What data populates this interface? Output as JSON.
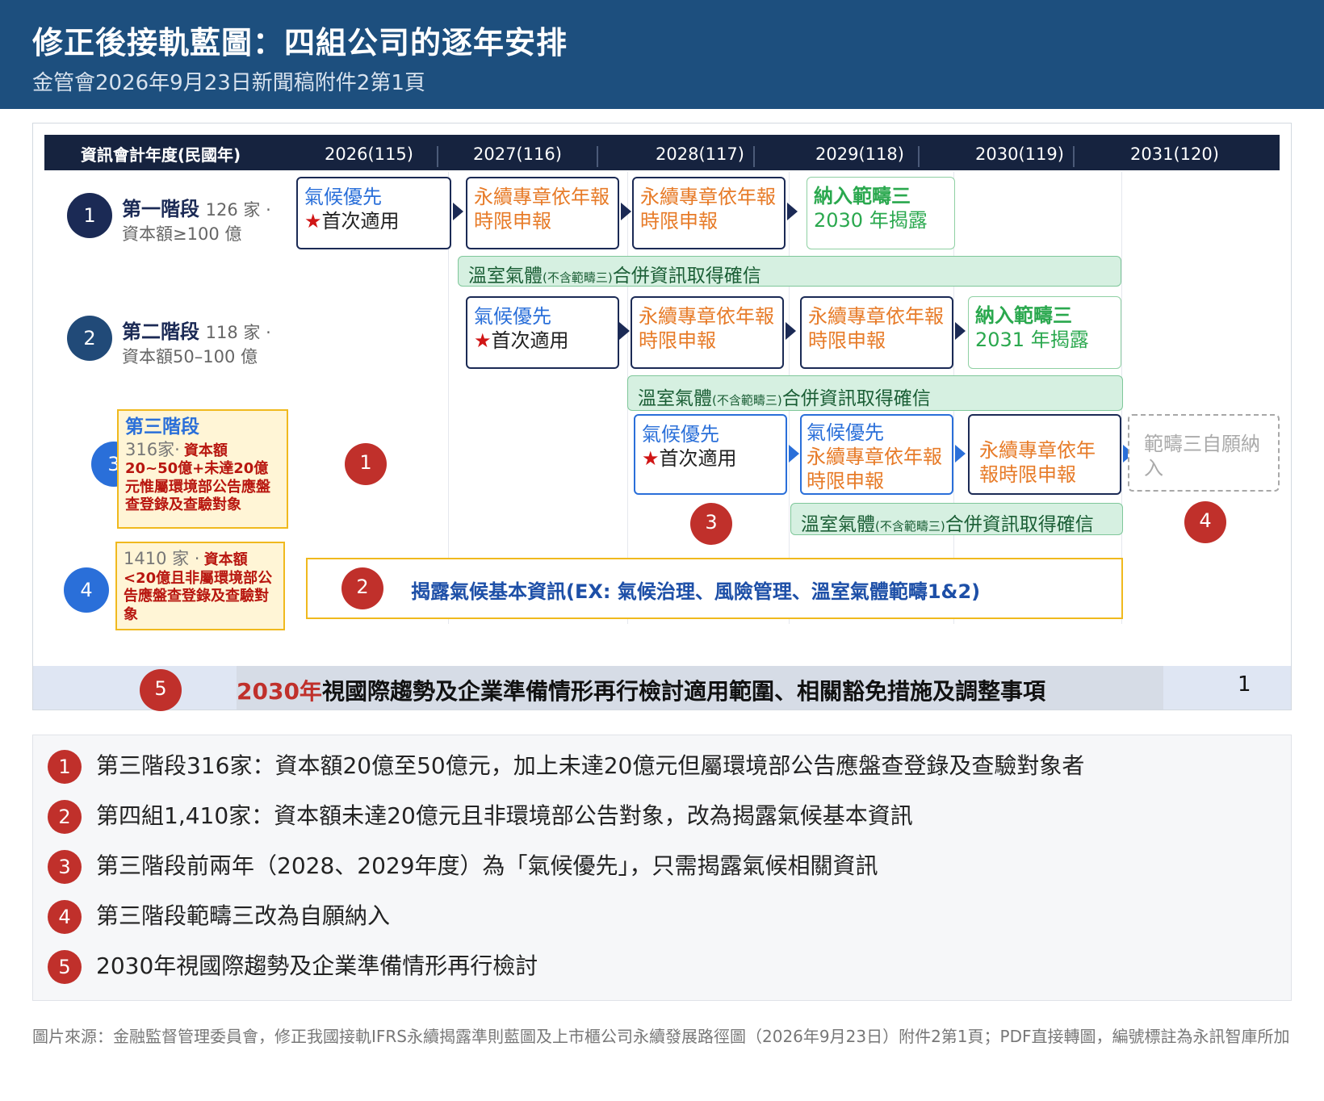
{
  "header": {
    "title": "修正後接軌藍圖：四組公司的逐年安排",
    "subtitle": "金管會2026年9月23日新聞稿附件2第1頁"
  },
  "yearbar": {
    "label": "資訊會計年度(民國年)",
    "years": [
      "2026(115)",
      "2027(116)",
      "2028(117)",
      "2029(118)",
      "2030(119)",
      "2031(120)"
    ]
  },
  "stages": [
    {
      "num": "1",
      "name": "第一階段",
      "count": "126 家 ·",
      "desc": "資本額≥100 億"
    },
    {
      "num": "2",
      "name": "第二階段",
      "count": "118 家 ·",
      "desc": "資本額50–100 億"
    },
    {
      "num": "3",
      "name": "第三階段",
      "count": "316家·",
      "desc": "資本額20~50億+未達20億元惟屬環境部公告應盤查登錄及查驗對象"
    },
    {
      "num": "4",
      "count": "1410 家 ·",
      "desc": "資本額<20億且非屬環境部公告應盤查登錄及查驗對象"
    }
  ],
  "boxes": {
    "climate_first_line1": "氣候優先",
    "first_apply": "首次適用",
    "star": "★",
    "annual_line1": "永續專章依年報",
    "annual_line2": "時限申報",
    "annual_split1": "永續專章依年",
    "annual_split2": "報時限申報",
    "scope3_title": "納入範疇三",
    "scope3_2030": "2030 年揭露",
    "scope3_2031": "2031 年揭露",
    "voluntary": "範疇三自願納入"
  },
  "green_bar": {
    "before": "溫室氣體",
    "small": "(不含範疇三)",
    "after": "合併資訊取得確信"
  },
  "disclosure_bar": "揭露氣候基本資訊(EX: 氣候治理、風險管理、溫室氣體範疇1&2)",
  "markers": [
    "1",
    "2",
    "3",
    "4",
    "5"
  ],
  "bottom": {
    "red": "2030年",
    "text": "視國際趨勢及企業準備情形再行檢討適用範圍、相關豁免措施及調整事項",
    "page": "1"
  },
  "notes": [
    {
      "num": "1",
      "text": "第三階段316家：資本額20億至50億元，加上未達20億元但屬環境部公告應盤查登錄及查驗對象者"
    },
    {
      "num": "2",
      "text": "第四組1,410家：資本額未達20億元且非環境部公告對象，改為揭露氣候基本資訊"
    },
    {
      "num": "3",
      "text": "第三階段前兩年（2028、2029年度）為「氣候優先」，只需揭露氣候相關資訊"
    },
    {
      "num": "4",
      "text": "第三階段範疇三改為自願納入"
    },
    {
      "num": "5",
      "text": "2030年視國際趨勢及企業準備情形再行檢討"
    }
  ],
  "source": "圖片來源：金融監督管理委員會，修正我國接軌IFRS永續揭露準則藍圖及上市櫃公司永續發展路徑圖（2026年9月23日）附件2第1頁；PDF直接轉圖，編號標註為永訊智庫所加",
  "colors": {
    "header_bg": "#1d4f7e",
    "navy": "#1b2a55",
    "blue": "#2a6fd9",
    "orange": "#e77b28",
    "green": "#2aa84e",
    "marker_red": "#c0302b",
    "yellow_border": "#f0b91e"
  }
}
